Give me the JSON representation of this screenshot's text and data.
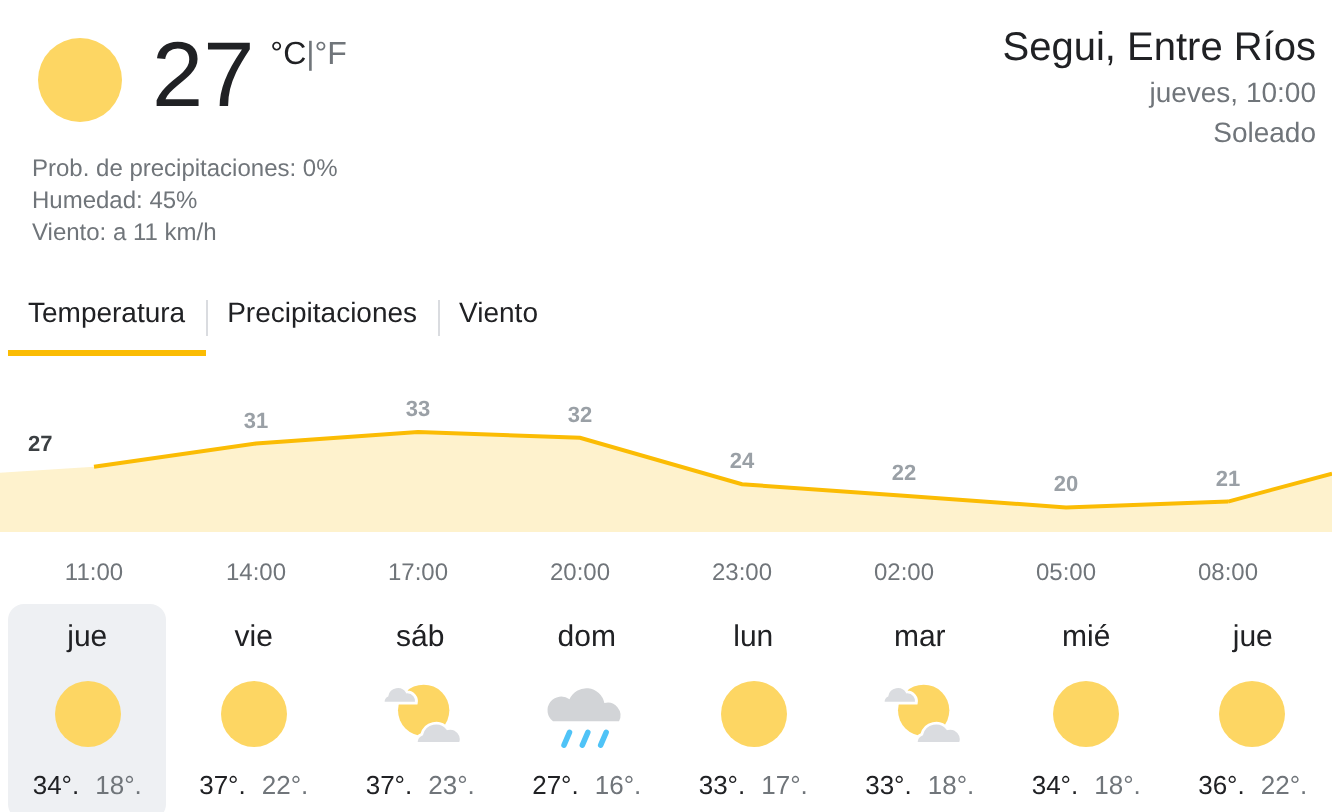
{
  "current": {
    "kind": "sun",
    "temperature": "27",
    "units": [
      {
        "label": "°C",
        "selected": true
      },
      {
        "label": "°F",
        "selected": false
      }
    ],
    "unit_separator": "|",
    "details": [
      "Prob. de precipitaciones: 0%",
      "Humedad: 45%",
      "Viento: a 11 km/h"
    ]
  },
  "location": {
    "name": "Segui, Entre Ríos",
    "time": "jueves, 10:00",
    "condition": "Soleado"
  },
  "tabs": [
    {
      "label": "Temperatura",
      "selected": true
    },
    {
      "label": "Precipitaciones",
      "selected": false
    },
    {
      "label": "Viento",
      "selected": false
    }
  ],
  "chart_data": {
    "type": "area",
    "categories": [
      "11:00",
      "14:00",
      "17:00",
      "20:00",
      "23:00",
      "02:00",
      "05:00",
      "08:00"
    ],
    "series": [
      {
        "color": "#fbbc04",
        "values": [
          27,
          31,
          33,
          32,
          24,
          22,
          20,
          21
        ]
      }
    ],
    "data_labels": true
  },
  "days": [
    {
      "day": "jue",
      "kind": "sun",
      "high": "34°.",
      "low": "18°.",
      "selected": true
    },
    {
      "day": "vie",
      "kind": "sun",
      "high": "37°.",
      "low": "22°.",
      "selected": false
    },
    {
      "day": "sáb",
      "kind": "partly-cloudy",
      "high": "37°.",
      "low": "23°.",
      "selected": false
    },
    {
      "day": "dom",
      "kind": "rain",
      "high": "27°.",
      "low": "16°.",
      "selected": false
    },
    {
      "day": "lun",
      "kind": "sun",
      "high": "33°.",
      "low": "17°.",
      "selected": false
    },
    {
      "day": "mar",
      "kind": "partly-cloudy",
      "high": "33°.",
      "low": "18°.",
      "selected": false
    },
    {
      "day": "mié",
      "kind": "sun",
      "high": "34°.",
      "low": "18°.",
      "selected": false
    },
    {
      "day": "jue",
      "kind": "sun",
      "high": "36°.",
      "low": "22°.",
      "selected": false
    }
  ]
}
